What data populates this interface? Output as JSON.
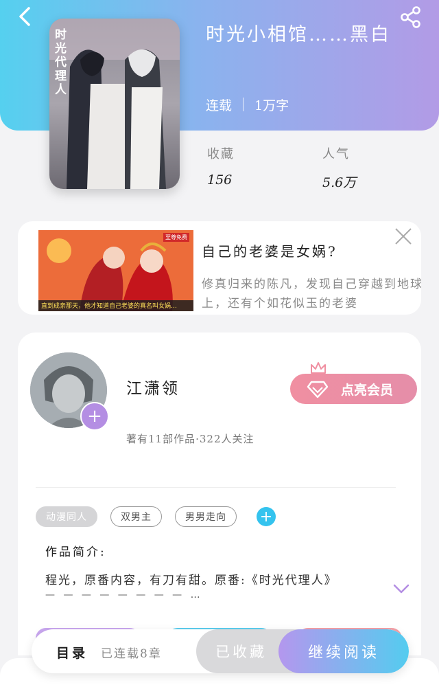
{
  "header": {
    "book_title": "时光小相馆……黑白",
    "status": "连载",
    "word_count": "1万字",
    "stats": [
      {
        "label": "收藏",
        "value": "156"
      },
      {
        "label": "人气",
        "value": "5.6万"
      }
    ],
    "cover_text": "时光代理人"
  },
  "ad": {
    "title": "自己的老婆是女娲?",
    "description": "修真归来的陈凡，发现自己穿越到地球上，还有个如花似玉的老婆",
    "image_caption": "直到成亲那天，他才知道自己老婆的真名叫女娲…",
    "badge": "至尊免费"
  },
  "author": {
    "name": "江潇领",
    "meta": "著有11部作品·322人关注",
    "vip_label": "点亮会员"
  },
  "tags": [
    "动漫同人",
    "双男主",
    "男男走向"
  ],
  "intro": {
    "label": "作品简介:",
    "text": "程光，原番内容，有刀有甜。原番:《时光代理人》",
    "dashes": "— — — — — — — — …"
  },
  "bottom_bar": {
    "toc_label": "目录",
    "chapter_count": "已连载8章",
    "collect_label": "已收藏",
    "read_label": "继续阅读"
  },
  "colors": {
    "accent_purple": "#b48ee3",
    "accent_blue": "#34c3ee",
    "vip_pink": "#f08fa1"
  }
}
